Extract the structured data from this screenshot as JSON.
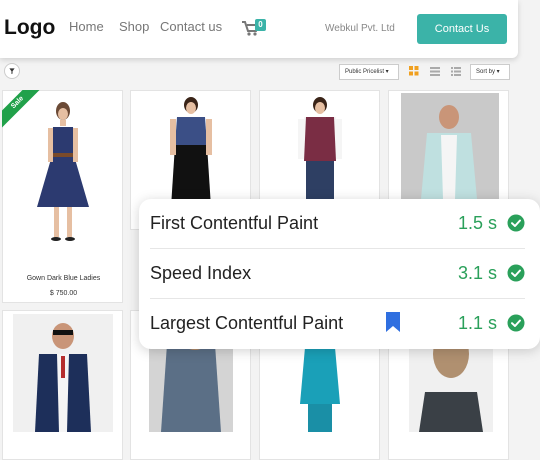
{
  "nav": {
    "logo": "Logo",
    "links": [
      "Home",
      "Shop",
      "Contact us"
    ],
    "cart_count": "0",
    "company": "Webkul Pvt. Ltd",
    "contact_button": "Contact Us"
  },
  "toolbar": {
    "pricelist": "Public Pricelist",
    "sort": "Sort by"
  },
  "products": {
    "sale_badge": "Sale",
    "first_name": "Gown Dark Blue Ladies",
    "first_price": "$ 750.00"
  },
  "metrics": [
    {
      "label": "First Contentful Paint",
      "value": "1.5 s"
    },
    {
      "label": "Speed Index",
      "value": "3.1 s"
    },
    {
      "label": "Largest Contentful Paint",
      "value": "1.1 s"
    }
  ],
  "colors": {
    "accent": "#3bb3a8",
    "sale": "#21a14a",
    "good": "#2aa05a",
    "bookmark": "#2f6fe0"
  }
}
